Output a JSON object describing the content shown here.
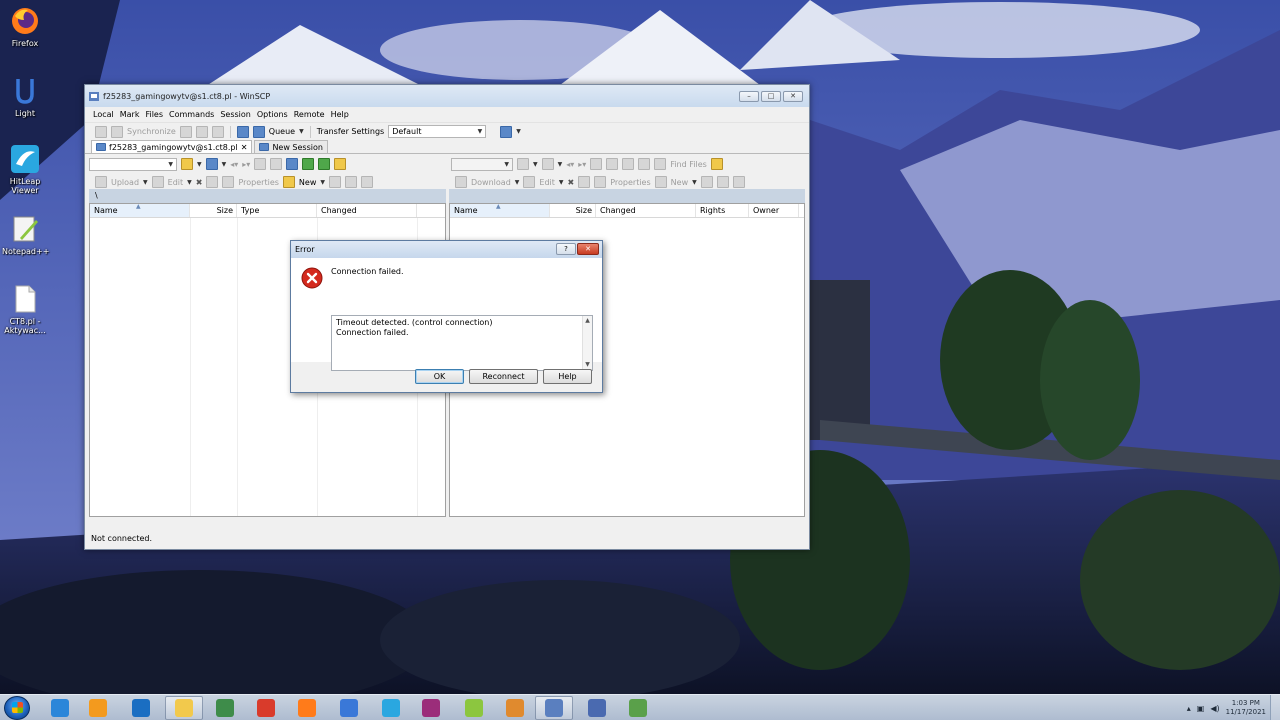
{
  "desktop": {
    "icons": [
      {
        "label": "Firefox",
        "icon": "firefox-icon"
      },
      {
        "label": "Light",
        "icon": "light-icon"
      },
      {
        "label": "HitLeap Viewer",
        "icon": "hitleap-icon"
      },
      {
        "label": "Notepad++",
        "icon": "notepadpp-icon"
      },
      {
        "label": "CT8.pl - Aktywac...",
        "icon": "file-icon"
      }
    ]
  },
  "winscp": {
    "title": "f25283_gamingowytv@s1.ct8.pl - WinSCP",
    "window_buttons": [
      "–",
      "□",
      "✕"
    ],
    "menu": [
      "Local",
      "Mark",
      "Files",
      "Commands",
      "Session",
      "Options",
      "Remote",
      "Help"
    ],
    "toolbar": {
      "synchronize": "Synchronize",
      "queue": "Queue",
      "transfer_settings_label": "Transfer Settings",
      "transfer_settings_value": "Default"
    },
    "tabs": [
      {
        "label": "f25283_gamingowytv@s1.ct8.pl",
        "close": "✕"
      },
      {
        "label": "New Session"
      }
    ],
    "left_panel": {
      "path": "\\",
      "actions": {
        "upload": "Upload",
        "edit": "Edit",
        "properties": "Properties",
        "new": "New"
      },
      "columns": [
        "Name",
        "Size",
        "Type",
        "Changed"
      ]
    },
    "right_panel": {
      "find_files": "Find Files",
      "actions": {
        "download": "Download",
        "edit": "Edit",
        "properties": "Properties",
        "new": "New"
      },
      "columns": [
        "Name",
        "Size",
        "Changed",
        "Rights",
        "Owner"
      ]
    },
    "status": "Not connected."
  },
  "error_dialog": {
    "title": "Error",
    "help_glyph": "?",
    "close_glyph": "✕",
    "message": "Connection failed.",
    "details": [
      "Timeout detected. (control connection)",
      "Connection failed."
    ],
    "buttons": {
      "ok": "OK",
      "reconnect": "Reconnect",
      "help": "Help"
    }
  },
  "taskbar": {
    "apps": [
      {
        "name": "ie-icon",
        "color": "#2b86d9"
      },
      {
        "name": "media-player-icon",
        "color": "#f39a1e"
      },
      {
        "name": "dell-icon",
        "color": "#1a6ec2"
      },
      {
        "name": "explorer-icon",
        "color": "#f2c94c"
      },
      {
        "name": "window-icon",
        "color": "#3e8c4a"
      },
      {
        "name": "psiphon-icon",
        "color": "#d93b2b"
      },
      {
        "name": "firefox-icon",
        "color": "#ff7b1a"
      },
      {
        "name": "light-icon",
        "color": "#3a78d8"
      },
      {
        "name": "hitleap-icon",
        "color": "#2aa7e0"
      },
      {
        "name": "winrar-icon",
        "color": "#9b2d7a"
      },
      {
        "name": "notepadpp-icon",
        "color": "#8cc63f"
      },
      {
        "name": "sublime-icon",
        "color": "#e08a2e"
      },
      {
        "name": "winscp-icon",
        "color": "#5a7fbf"
      },
      {
        "name": "network-app-icon",
        "color": "#4a6ab0"
      },
      {
        "name": "cheat-engine-icon",
        "color": "#5aa04a"
      }
    ],
    "clock_time": "1:03 PM",
    "clock_date": "11/17/2021",
    "tray_up": "▴"
  }
}
